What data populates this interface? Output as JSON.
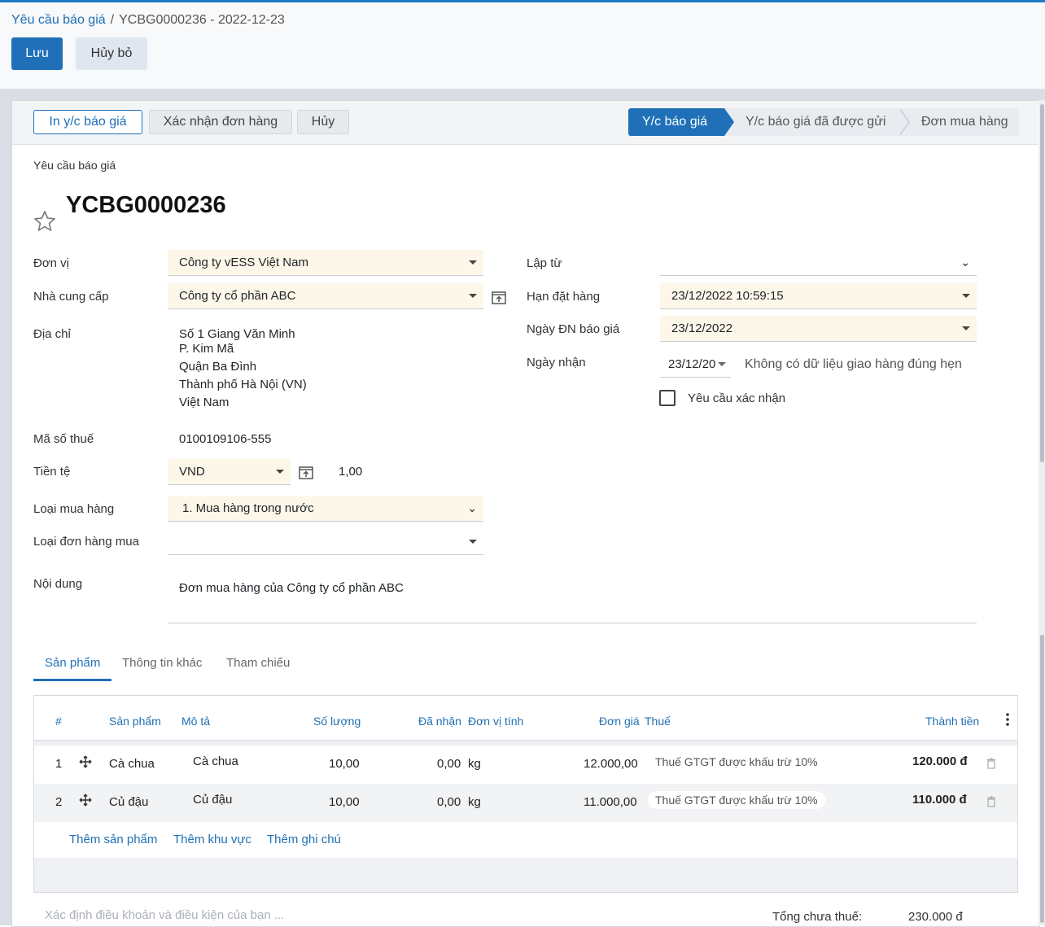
{
  "breadcrumb": {
    "parent": "Yêu cầu báo giá",
    "separator": "/",
    "current": "YCBG0000236 - 2022-12-23"
  },
  "actions": {
    "save": "Lưu",
    "discard": "Hủy bỏ"
  },
  "statusbar": {
    "buttons": [
      "In y/c báo giá",
      "Xác nhận đơn hàng",
      "Hủy"
    ],
    "stages": [
      "Y/c báo giá",
      "Y/c báo giá đã được gửi",
      "Đơn mua hàng"
    ],
    "active_stage": "Y/c báo giá"
  },
  "form": {
    "doc_type": "Yêu cầu báo giá",
    "name": "YCBG0000236",
    "left": {
      "company_label": "Đơn vị",
      "company": "Công ty vESS Việt Nam",
      "vendor_label": "Nhà cung cấp",
      "vendor": "Công ty cổ phần ABC",
      "address_label": "Địa chỉ",
      "address_lines": [
        "Số 1 Giang Văn Minh",
        "P. Kim Mã",
        "Quận Ba Đình",
        "Thành phố Hà Nội (VN)",
        "Việt Nam"
      ],
      "tax_label": "Mã số thuế",
      "tax": "0100109106-555",
      "currency_label": "Tiền tệ",
      "currency": "VND",
      "rate": "1,00",
      "purchase_type_label": "Loại mua hàng",
      "purchase_type": "1. Mua hàng trong nước",
      "order_type_label": "Loại đơn hàng mua",
      "order_type": "",
      "content_label": "Nội dung",
      "content": "Đơn mua hàng của Công ty cổ phần ABC"
    },
    "right": {
      "source_label": "Lập từ",
      "source": "",
      "deadline_label": "Hạn đặt hàng",
      "deadline": "23/12/2022 10:59:15",
      "quote_date_label": "Ngày ĐN báo giá",
      "quote_date": "23/12/2022",
      "receipt_label": "Ngày nhận",
      "receipt": "23/12/20",
      "receipt_note": "Không có dữ liệu giao hàng đúng hẹn",
      "confirm_label": "Yêu cầu xác nhận",
      "confirm_checked": false
    }
  },
  "tabs": [
    "Sản phẩm",
    "Thông tin khác",
    "Tham chiếu"
  ],
  "active_tab": "Sản phẩm",
  "lines": {
    "headers": {
      "no": "#",
      "product": "Sản phẩm",
      "desc": "Mô tả",
      "qty": "Số lượng",
      "received": "Đã nhận",
      "uom": "Đơn vị tính",
      "price": "Đơn giá",
      "tax": "Thuế",
      "subtotal": "Thành tiền"
    },
    "rows": [
      {
        "no": "1",
        "product": "Cà chua",
        "desc": "Cà chua",
        "qty": "10,00",
        "received": "0,00",
        "uom": "kg",
        "price": "12.000,00",
        "tax": "Thuế GTGT được khấu trừ 10%",
        "subtotal": "120.000 đ"
      },
      {
        "no": "2",
        "product": "Củ đậu",
        "desc": "Củ đậu",
        "qty": "10,00",
        "received": "0,00",
        "uom": "kg",
        "price": "11.000,00",
        "tax": "Thuế GTGT được khấu trừ 10%",
        "subtotal": "110.000 đ"
      }
    ],
    "add_links": [
      "Thêm sản phẩm",
      "Thêm khu vực",
      "Thêm ghi chú"
    ]
  },
  "footer": {
    "terms_placeholder": "Xác định điều khoản và điều kiện của bạn ...",
    "untaxed_label": "Tổng chưa thuế:",
    "untaxed": "230.000 đ"
  },
  "colors": {
    "primary": "#1f70b8",
    "required_bg": "#fdf7e9",
    "row_alt": "#f1f3f5"
  }
}
